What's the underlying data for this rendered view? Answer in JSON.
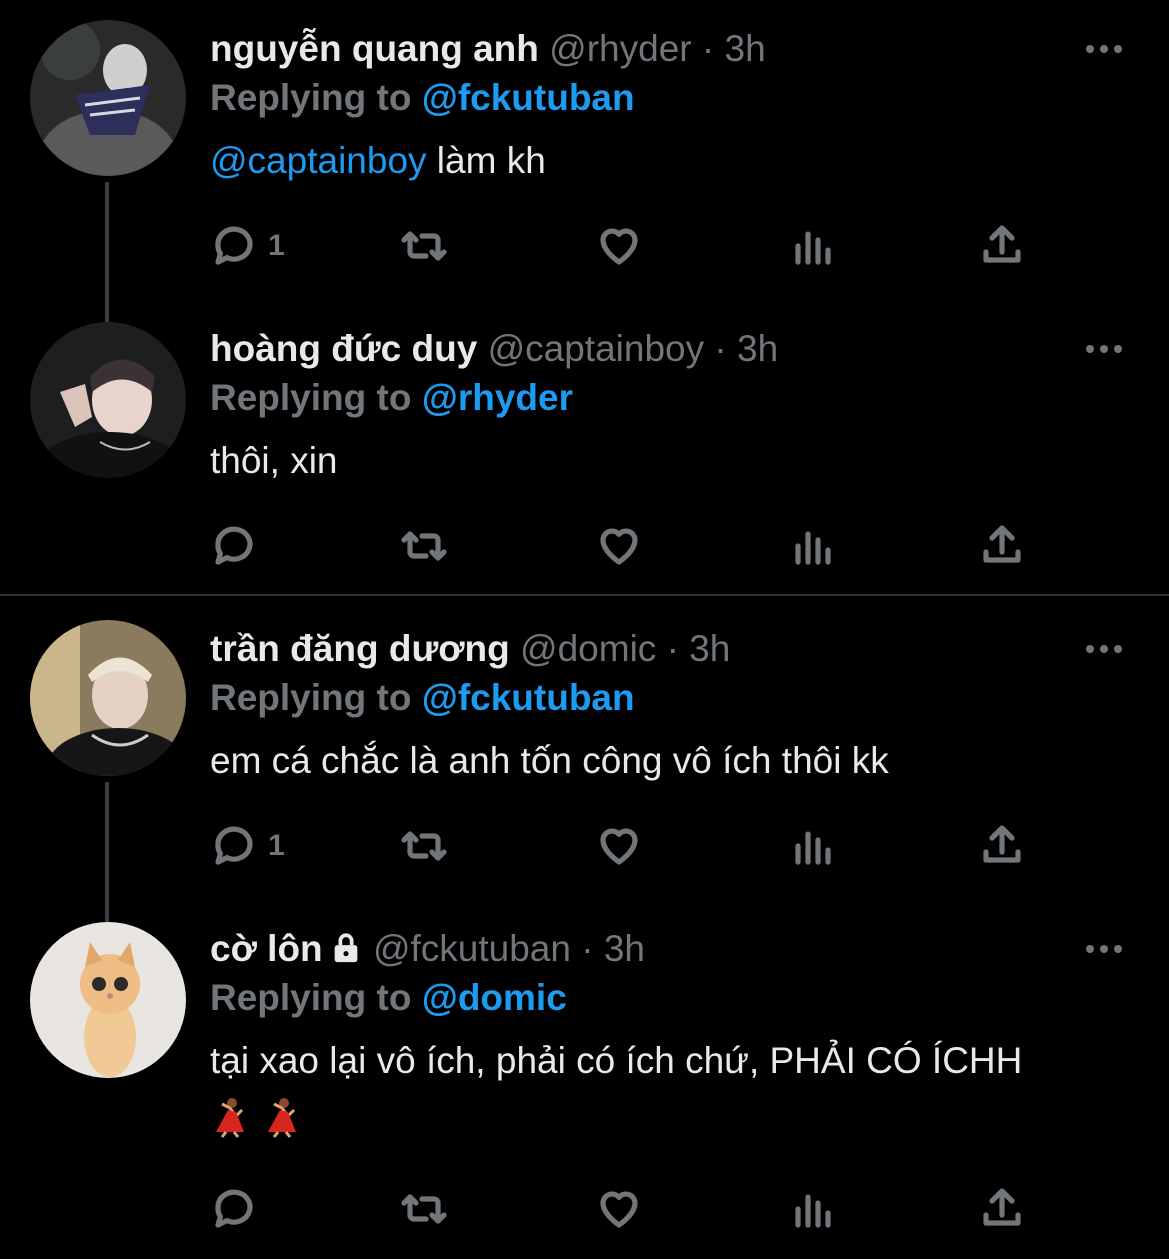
{
  "tweets": [
    {
      "name": "nguyễn quang anh",
      "handle": "@rhyder",
      "time": "· 3h",
      "replying_label": "Replying to",
      "replying_to": "@fckutuban",
      "mention": "@captainboy",
      "text": " làm kh",
      "reply_count": "1",
      "avatar_icon": "user-photo-bandana"
    },
    {
      "name": "hoàng đức duy",
      "handle": "@captainboy",
      "time": "· 3h",
      "replying_label": "Replying to",
      "replying_to": "@rhyder",
      "text": "thôi, xin",
      "reply_count": "",
      "avatar_icon": "user-photo-hand-sign"
    },
    {
      "name": "trần đăng dương",
      "handle": "@domic",
      "time": "· 3h",
      "replying_label": "Replying to",
      "replying_to": "@fckutuban",
      "text": "em cá chắc là anh tốn công vô ích thôi kk",
      "reply_count": "1",
      "avatar_icon": "user-photo-blond"
    },
    {
      "name": "cờ lôn",
      "handle": "@fckutuban",
      "time": "· 3h",
      "replying_label": "Replying to",
      "replying_to": "@domic",
      "text": "tại xao lại vô ích, phải có ích chứ, PHẢI CÓ ÍCHH",
      "emoji": [
        "dancer-emoji",
        "dancer-emoji"
      ],
      "reply_count": "",
      "locked": true,
      "avatar_icon": "kitten-photo"
    }
  ],
  "icons": {
    "reply": "reply-icon",
    "retweet": "retweet-icon",
    "like": "heart-icon",
    "analytics": "analytics-icon",
    "share": "share-icon",
    "more": "more-icon",
    "lock": "lock-icon"
  },
  "colors": {
    "background": "#000000",
    "text": "#e7e9ea",
    "muted": "#71767b",
    "accent": "#1d9bf0"
  }
}
